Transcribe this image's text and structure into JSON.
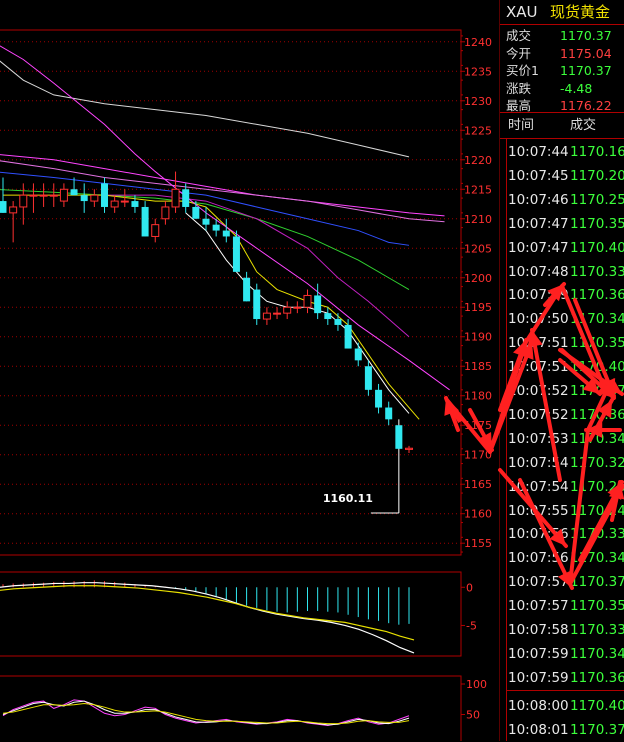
{
  "header": {
    "symbol": "XAU",
    "name": "现货黄金"
  },
  "quote": [
    {
      "label": "成交",
      "value": "1170.37",
      "color": "#3cff3c"
    },
    {
      "label": "今开",
      "value": "1175.04",
      "color": "#ff4040"
    },
    {
      "label": "买价1",
      "value": "1170.37",
      "color": "#3cff3c"
    },
    {
      "label": "涨跌",
      "value": "-4.48",
      "color": "#3cff3c"
    },
    {
      "label": "最高",
      "value": "1176.22",
      "color": "#ff4040"
    }
  ],
  "ticks_header": {
    "time": "时间",
    "price": "成交"
  },
  "ticks": [
    {
      "time": "10:07:44",
      "price": "1170.16"
    },
    {
      "time": "10:07:45",
      "price": "1170.20"
    },
    {
      "time": "10:07:46",
      "price": "1170.25"
    },
    {
      "time": "10:07:47",
      "price": "1170.35"
    },
    {
      "time": "10:07:47",
      "price": "1170.40"
    },
    {
      "time": "10:07:48",
      "price": "1170.33"
    },
    {
      "time": "10:07:49",
      "price": "1170.36"
    },
    {
      "time": "10:07:50",
      "price": "1170.34"
    },
    {
      "time": "10:07:51",
      "price": "1170.35"
    },
    {
      "time": "10:07:51",
      "price": "1170.40"
    },
    {
      "time": "10:07:52",
      "price": "1170.37"
    },
    {
      "time": "10:07:52",
      "price": "1170.36"
    },
    {
      "time": "10:07:53",
      "price": "1170.34"
    },
    {
      "time": "10:07:54",
      "price": "1170.32"
    },
    {
      "time": "10:07:54",
      "price": "1170.26"
    },
    {
      "time": "10:07:55",
      "price": "1170.24"
    },
    {
      "time": "10:07:56",
      "price": "1170.33"
    },
    {
      "time": "10:07:56",
      "price": "1170.34"
    },
    {
      "time": "10:07:57",
      "price": "1170.37"
    },
    {
      "time": "10:07:57",
      "price": "1170.35"
    },
    {
      "time": "10:07:58",
      "price": "1170.33"
    },
    {
      "time": "10:07:59",
      "price": "1170.34"
    },
    {
      "time": "10:07:59",
      "price": "1170.36"
    },
    {
      "time": "10:08:00",
      "price": "1170.40"
    },
    {
      "time": "10:08:01",
      "price": "1170.37"
    }
  ],
  "chart_data": [
    {
      "type": "candlestick",
      "ylim": [
        1153,
        1242
      ],
      "ytick_labels": [
        "1240",
        "1235",
        "1230",
        "1225",
        "1220",
        "1215",
        "1210",
        "1205",
        "1200",
        "1195",
        "1190",
        "1185",
        "1180",
        "1175",
        "1170",
        "1165",
        "1160",
        "1155"
      ],
      "annotation": "1160.11",
      "candles": [
        {
          "o": 1213,
          "h": 1217,
          "l": 1211,
          "c": 1211
        },
        {
          "o": 1211,
          "h": 1213,
          "l": 1206,
          "c": 1212
        },
        {
          "o": 1212,
          "h": 1216,
          "l": 1209,
          "c": 1214
        },
        {
          "o": 1214,
          "h": 1216,
          "l": 1211,
          "c": 1214
        },
        {
          "o": 1214,
          "h": 1216,
          "l": 1212,
          "c": 1214
        },
        {
          "o": 1214,
          "h": 1216,
          "l": 1212,
          "c": 1214
        },
        {
          "o": 1213,
          "h": 1216,
          "l": 1212,
          "c": 1215
        },
        {
          "o": 1215,
          "h": 1217,
          "l": 1214,
          "c": 1214
        },
        {
          "o": 1214,
          "h": 1216,
          "l": 1211,
          "c": 1213
        },
        {
          "o": 1213,
          "h": 1215,
          "l": 1212,
          "c": 1214
        },
        {
          "o": 1216,
          "h": 1217,
          "l": 1211,
          "c": 1212
        },
        {
          "o": 1212,
          "h": 1214,
          "l": 1211,
          "c": 1213
        },
        {
          "o": 1213,
          "h": 1215,
          "l": 1212,
          "c": 1213
        },
        {
          "o": 1213,
          "h": 1214,
          "l": 1211,
          "c": 1212
        },
        {
          "o": 1212,
          "h": 1213,
          "l": 1207,
          "c": 1207
        },
        {
          "o": 1207,
          "h": 1210,
          "l": 1206,
          "c": 1209
        },
        {
          "o": 1210,
          "h": 1213,
          "l": 1209,
          "c": 1212
        },
        {
          "o": 1212,
          "h": 1218,
          "l": 1211,
          "c": 1215
        },
        {
          "o": 1215,
          "h": 1216,
          "l": 1211,
          "c": 1212
        },
        {
          "o": 1212,
          "h": 1213,
          "l": 1210,
          "c": 1210
        },
        {
          "o": 1210,
          "h": 1212,
          "l": 1208,
          "c": 1209
        },
        {
          "o": 1209,
          "h": 1210,
          "l": 1207,
          "c": 1208
        },
        {
          "o": 1208,
          "h": 1210,
          "l": 1206,
          "c": 1207
        },
        {
          "o": 1207,
          "h": 1208,
          "l": 1201,
          "c": 1201
        },
        {
          "o": 1200,
          "h": 1201,
          "l": 1196,
          "c": 1196
        },
        {
          "o": 1198,
          "h": 1199,
          "l": 1192,
          "c": 1193
        },
        {
          "o": 1193,
          "h": 1195,
          "l": 1192,
          "c": 1194
        },
        {
          "o": 1194,
          "h": 1195,
          "l": 1193,
          "c": 1194
        },
        {
          "o": 1194,
          "h": 1196,
          "l": 1193,
          "c": 1195
        },
        {
          "o": 1195,
          "h": 1196,
          "l": 1194,
          "c": 1195
        },
        {
          "o": 1195,
          "h": 1198,
          "l": 1194,
          "c": 1197
        },
        {
          "o": 1197,
          "h": 1199,
          "l": 1193,
          "c": 1194
        },
        {
          "o": 1194,
          "h": 1195,
          "l": 1192,
          "c": 1193
        },
        {
          "o": 1193,
          "h": 1194,
          "l": 1191,
          "c": 1192
        },
        {
          "o": 1192,
          "h": 1193,
          "l": 1188,
          "c": 1188
        },
        {
          "o": 1188,
          "h": 1189,
          "l": 1185,
          "c": 1186
        },
        {
          "o": 1185,
          "h": 1186,
          "l": 1180,
          "c": 1181
        },
        {
          "o": 1181,
          "h": 1182,
          "l": 1177,
          "c": 1178
        },
        {
          "o": 1178,
          "h": 1179,
          "l": 1175,
          "c": 1176
        },
        {
          "o": 1175,
          "h": 1176,
          "l": 1160.11,
          "c": 1171
        },
        {
          "o": 1170.9,
          "h": 1171.5,
          "l": 1170.3,
          "c": 1171.1
        }
      ],
      "ma_lines": [
        {
          "color": "#d8d8d8",
          "points": [
            [
              -1,
              1239
            ],
            [
              -0.5,
              1237
            ],
            [
              2,
              1233.5
            ],
            [
              5,
              1231
            ],
            [
              10,
              1229.5
            ],
            [
              15,
              1228.5
            ],
            [
              20,
              1227.5
            ],
            [
              25,
              1226
            ],
            [
              30,
              1224.5
            ],
            [
              35,
              1222.5
            ],
            [
              40,
              1220.5
            ]
          ]
        },
        {
          "color": "#ff44ff",
          "points": [
            [
              -1,
              1221
            ],
            [
              5,
              1220
            ],
            [
              10,
              1218.5
            ],
            [
              15,
              1217
            ],
            [
              20,
              1215.5
            ],
            [
              25,
              1214
            ],
            [
              30,
              1213
            ],
            [
              35,
              1212
            ],
            [
              40,
              1211
            ],
            [
              43.5,
              1210.5
            ]
          ]
        },
        {
          "color": "#e070e0",
          "points": [
            [
              -1,
              1220
            ],
            [
              5,
              1218.5
            ],
            [
              10,
              1217
            ],
            [
              15,
              1216
            ],
            [
              20,
              1215
            ],
            [
              25,
              1214
            ],
            [
              30,
              1213
            ],
            [
              35,
              1211.5
            ],
            [
              40,
              1210
            ],
            [
              43.5,
              1209.5
            ]
          ]
        },
        {
          "color": "#3050ff",
          "points": [
            [
              -1,
              1218
            ],
            [
              5,
              1217
            ],
            [
              10,
              1216
            ],
            [
              15,
              1215
            ],
            [
              20,
              1214
            ],
            [
              25,
              1212
            ],
            [
              30,
              1210
            ],
            [
              35,
              1208
            ],
            [
              38,
              1206
            ],
            [
              40,
              1205.5
            ]
          ]
        },
        {
          "color": "#30d030",
          "points": [
            [
              -1,
              1215
            ],
            [
              5,
              1214.5
            ],
            [
              10,
              1214
            ],
            [
              15,
              1213.5
            ],
            [
              20,
              1212.5
            ],
            [
              25,
              1210
            ],
            [
              30,
              1207
            ],
            [
              35,
              1203
            ],
            [
              38,
              1200
            ],
            [
              40,
              1198
            ]
          ]
        },
        {
          "color": "#c020c0",
          "points": [
            [
              10,
              1214
            ],
            [
              15,
              1214
            ],
            [
              20,
              1213
            ],
            [
              25,
              1210
            ],
            [
              30,
              1205
            ],
            [
              33,
              1200
            ],
            [
              36,
              1196
            ],
            [
              40,
              1190
            ]
          ]
        },
        {
          "color": "#e8e000",
          "points": [
            [
              0,
              1214
            ],
            [
              5,
              1214
            ],
            [
              10,
              1214
            ],
            [
              15,
              1213
            ],
            [
              18,
              1213
            ],
            [
              20,
              1212
            ],
            [
              23,
              1207
            ],
            [
              25,
              1201
            ],
            [
              27,
              1198
            ],
            [
              30,
              1196
            ],
            [
              32,
              1195
            ],
            [
              34,
              1192
            ],
            [
              36,
              1187
            ],
            [
              38,
              1182
            ],
            [
              40,
              1178
            ],
            [
              41,
              1176
            ]
          ]
        },
        {
          "color": "#ffffff",
          "points": [
            [
              18,
              1211
            ],
            [
              20,
              1208
            ],
            [
              22,
              1203
            ],
            [
              24,
              1199
            ],
            [
              26,
              1196
            ],
            [
              28,
              1195
            ],
            [
              30,
              1195
            ],
            [
              32,
              1194
            ],
            [
              34,
              1191
            ],
            [
              36,
              1186
            ],
            [
              38,
              1181
            ],
            [
              40,
              1177
            ]
          ]
        },
        {
          "color": "#ff44ff",
          "points": [
            [
              -1,
              1240
            ],
            [
              2,
              1237
            ],
            [
              5,
              1233
            ],
            [
              10,
              1226
            ],
            [
              13,
              1221
            ],
            [
              15,
              1218
            ],
            [
              20,
              1211
            ],
            [
              25,
              1205
            ],
            [
              30,
              1199
            ],
            [
              35,
              1192
            ],
            [
              40,
              1186
            ],
            [
              42,
              1183.5
            ],
            [
              44,
              1181
            ]
          ]
        }
      ]
    },
    {
      "type": "bar",
      "ylim": [
        -9,
        2
      ],
      "ytick_labels": [
        "0",
        "-5"
      ],
      "values": [
        0.4,
        0.5,
        0.5,
        0.6,
        0.6,
        0.7,
        0.8,
        0.8,
        0.8,
        0.9,
        0.8,
        0.7,
        0.6,
        0.4,
        0.2,
        0.1,
        0.1,
        -0.2,
        -0.4,
        -0.6,
        -0.9,
        -1.2,
        -1.6,
        -2.0,
        -2.4,
        -2.7,
        -3.0,
        -3.2,
        -3.3,
        -3.2,
        -3.1,
        -3.1,
        -3.2,
        -3.3,
        -3.6,
        -3.9,
        -4.2,
        -4.4,
        -4.7,
        -4.9,
        -4.8
      ],
      "series": [
        {
          "color": "#ffffff",
          "values": [
            0,
            0.2,
            0.3,
            0.4,
            0.5,
            0.5,
            0.6,
            0.6,
            0.5,
            0.4,
            0.3,
            0.2,
            0,
            -0.2,
            -0.5,
            -0.9,
            -1.4,
            -2.0,
            -2.6,
            -3.1,
            -3.5,
            -3.8,
            -4.1,
            -4.3,
            -4.6,
            -5.0,
            -5.5,
            -6.2,
            -7.0,
            -7.9,
            -8.6
          ]
        },
        {
          "color": "#e8e000",
          "values": [
            -0.4,
            -0.2,
            -0.1,
            0,
            0.1,
            0.2,
            0.2,
            0.2,
            0.1,
            0,
            -0.1,
            -0.3,
            -0.5,
            -0.7,
            -1.0,
            -1.3,
            -1.7,
            -2.1,
            -2.6,
            -3.0,
            -3.4,
            -3.7,
            -4.0,
            -4.2,
            -4.4,
            -4.6,
            -5.0,
            -5.4,
            -5.8,
            -6.4,
            -6.9
          ]
        }
      ]
    },
    {
      "type": "line",
      "ylim": [
        0,
        100
      ],
      "ytick_labels": [
        "100",
        "50"
      ],
      "series": [
        {
          "color": "#ff44ff",
          "values": [
            48,
            58,
            64,
            70,
            72,
            60,
            66,
            74,
            72,
            62,
            52,
            48,
            50,
            56,
            62,
            60,
            50,
            44,
            40,
            36,
            38,
            40,
            42,
            38,
            36,
            34,
            36,
            38,
            42,
            40,
            36,
            34,
            32,
            35,
            40,
            44,
            38,
            34,
            36,
            42,
            48
          ]
        },
        {
          "color": "#ffffff",
          "values": [
            50,
            56,
            62,
            68,
            70,
            66,
            64,
            70,
            72,
            66,
            58,
            52,
            52,
            54,
            58,
            58,
            52,
            46,
            42,
            38,
            37,
            38,
            40,
            39,
            37,
            35,
            35,
            37,
            40,
            40,
            37,
            35,
            33,
            34,
            38,
            42,
            40,
            36,
            35,
            39,
            44
          ]
        },
        {
          "color": "#e8e000",
          "values": [
            52,
            54,
            58,
            62,
            66,
            66,
            65,
            66,
            68,
            66,
            62,
            57,
            54,
            54,
            55,
            56,
            54,
            50,
            46,
            42,
            40,
            39,
            39,
            39,
            38,
            37,
            36,
            36,
            38,
            39,
            38,
            36,
            35,
            35,
            36,
            39,
            40,
            38,
            37,
            37,
            40
          ]
        }
      ]
    }
  ]
}
